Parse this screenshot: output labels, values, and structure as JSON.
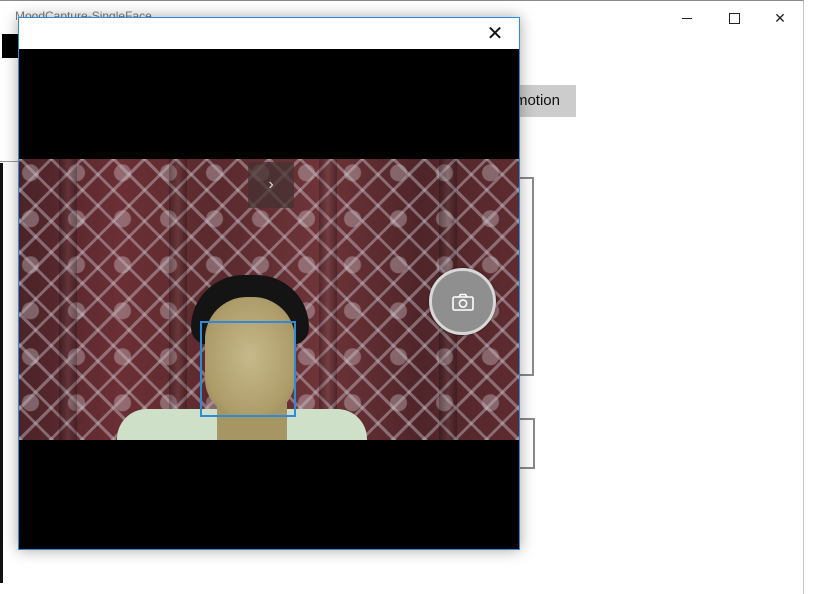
{
  "app": {
    "title": "MoodCapture-SingleFace",
    "emotion_button_label": "motion",
    "window_controls": {
      "minimize": "minimize-icon",
      "maximize": "maximize-icon",
      "close": "✕"
    }
  },
  "camera_dialog": {
    "close_glyph": "✕",
    "chevron_glyph": "›",
    "shutter_icon": "camera-icon",
    "face_box_color": "#2f8ad8"
  }
}
